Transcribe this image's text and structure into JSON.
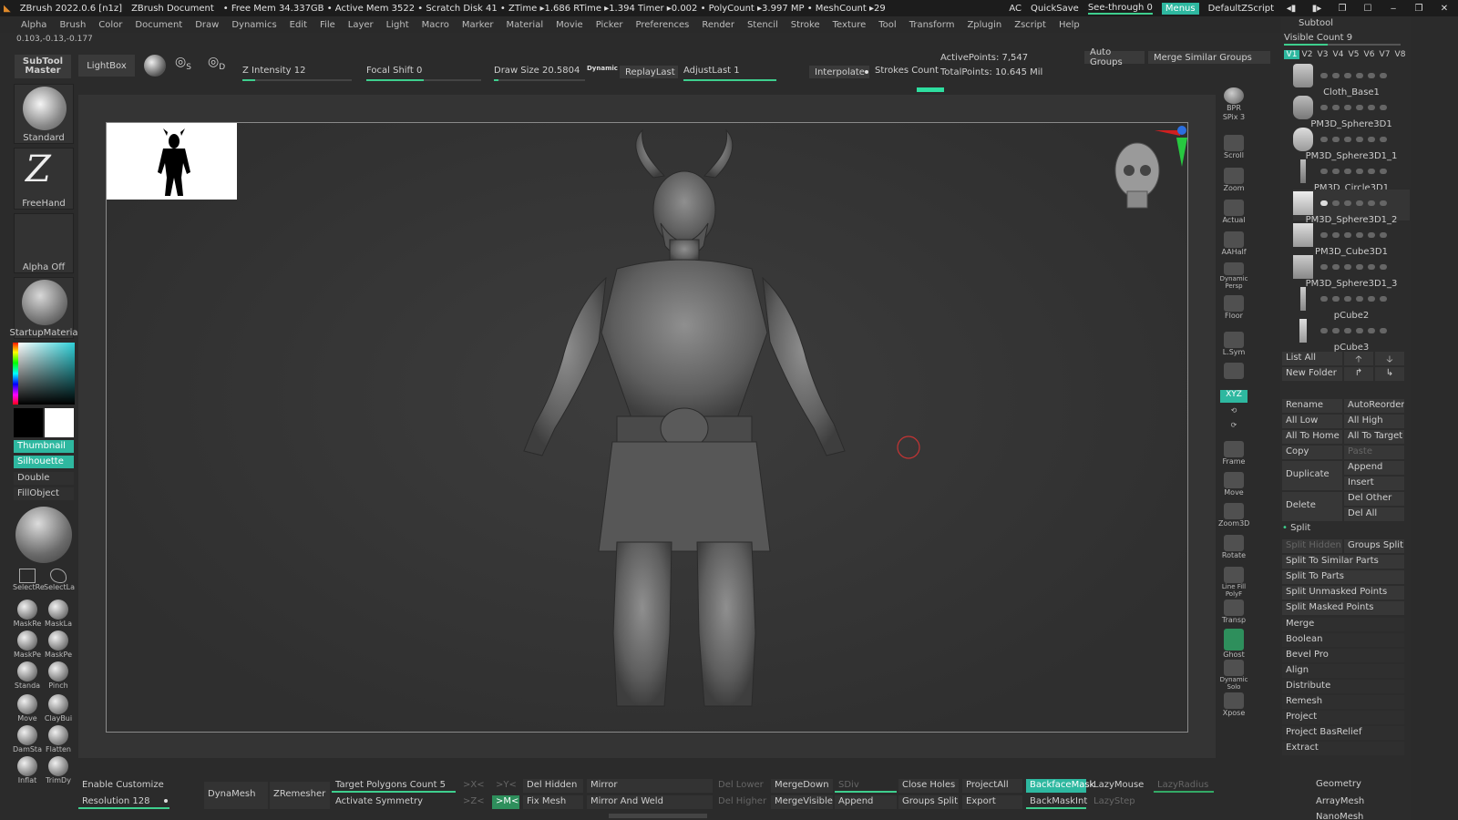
{
  "title_bar": {
    "app": "ZBrush 2022.0.6 [n1z]",
    "document": "ZBrush Document",
    "stats": "• Free Mem 34.337GB • Active Mem 3522 • Scratch Disk 41 • ZTime ▸1.686 RTime ▸1.394 Timer ▸0.002 • PolyCount ▸3.997 MP • MeshCount ▸29",
    "ac": "AC",
    "quicksave": "QuickSave",
    "see_through": "See-through   0",
    "menus": "Menus",
    "zscript": "DefaultZScript"
  },
  "menu": [
    "Alpha",
    "Brush",
    "Color",
    "Document",
    "Draw",
    "Dynamics",
    "Edit",
    "File",
    "Layer",
    "Light",
    "Macro",
    "Marker",
    "Material",
    "Movie",
    "Picker",
    "Preferences",
    "Render",
    "Stencil",
    "Stroke",
    "Texture",
    "Tool",
    "Transform",
    "Zplugin",
    "Zscript",
    "Help"
  ],
  "coords": "0.103,-0.13,-0.177",
  "top": {
    "subtool_master": "SubTool Master",
    "lightbox": "LightBox",
    "z_intensity": "Z Intensity 12",
    "focal_shift": "Focal Shift 0",
    "draw_size": "Draw Size 20.5804",
    "dynamic": "Dynamic",
    "replay_last": "ReplayLast",
    "adjust_last": "AdjustLast 1",
    "interpolate": "Interpolate",
    "strokes_count": "Strokes Count",
    "active_points": "ActivePoints: 7,547",
    "total_points": "TotalPoints: 10.645 Mil",
    "auto_groups": "Auto Groups",
    "merge_similar": "Merge Similar Groups",
    "z_intensity_level": 0.12,
    "focal_shift_level": 0.5,
    "draw_size_level": 0.05,
    "adjust_last_level": 1.0
  },
  "left": {
    "standard": "Standard",
    "freehand": "FreeHand",
    "alpha_off": "Alpha Off",
    "material": "StartupMateria",
    "thumbnail": "Thumbnail",
    "silhouette": "Silhouette",
    "double": "Double",
    "fillobject": "FillObject",
    "brushes": [
      "SelectRe",
      "SelectLa",
      "MaskRe",
      "MaskLa",
      "MaskPe",
      "MaskPe",
      "Standa",
      "Pinch",
      "Move",
      "ClayBui",
      "DamSta",
      "Flatten",
      "Inflat",
      "TrimDy"
    ]
  },
  "dock": [
    "BPR",
    "SPix 3",
    "Scroll",
    "Zoom",
    "Actual",
    "AAHalf",
    "Dynamic Persp",
    "Floor",
    "L.Sym",
    "",
    "XYZ",
    "",
    "",
    "Frame",
    "Move",
    "Zoom3D",
    "Rotate",
    "Line Fill PolyF",
    "Transp",
    "Ghost",
    "Dynamic Solo",
    "Xpose"
  ],
  "subtool": {
    "header": "Subtool",
    "visible_count": "Visible Count 9",
    "versions": [
      "V1",
      "V2",
      "V3",
      "V4",
      "V5",
      "V6",
      "V7",
      "V8"
    ],
    "items": [
      "Cloth_Base1",
      "PM3D_Sphere3D1",
      "PM3D_Sphere3D1_1",
      "PM3D_Circle3D1",
      "PM3D_Sphere3D1_2",
      "PM3D_Cube3D1",
      "PM3D_Sphere3D1_3",
      "pCube2",
      "pCube3"
    ],
    "list_all": "List All",
    "new_folder": "New Folder",
    "rename": "Rename",
    "autoreorder": "AutoReorder",
    "all_low": "All Low",
    "all_high": "All High",
    "all_to_home": "All To Home",
    "all_to_target": "All To Target",
    "copy": "Copy",
    "paste": "Paste",
    "duplicate": "Duplicate",
    "append": "Append",
    "insert": "Insert",
    "delete": "Delete",
    "del_other": "Del Other",
    "del_all": "Del All",
    "split": "Split",
    "split_hidden": "Split Hidden",
    "groups_split": "Groups Split",
    "split_similar": "Split To Similar Parts",
    "split_parts": "Split To Parts",
    "split_unmasked": "Split Unmasked Points",
    "split_masked": "Split Masked Points",
    "sections": [
      "Merge",
      "Boolean",
      "Bevel Pro",
      "Align",
      "Distribute",
      "Remesh",
      "Project",
      "Project BasRelief",
      "Extract"
    ],
    "geometry": "Geometry",
    "arraymesh": "ArrayMesh",
    "nanomesh": "NanoMesh"
  },
  "bottom": {
    "enable_customize": "Enable Customize",
    "resolution": "Resolution 128",
    "dynamesh": "DynaMesh",
    "zremesher": "ZRemesher",
    "target_polys": "Target Polygons Count 5",
    "activate_symmetry": "Activate Symmetry",
    "x": ">X<",
    "y": ">Y<",
    "z": ">Z<",
    "m": ">M<",
    "del_hidden": "Del Hidden",
    "fix_mesh": "Fix Mesh",
    "mirror": "Mirror",
    "mirror_weld": "Mirror And Weld",
    "del_lower": "Del Lower",
    "del_higher": "Del Higher",
    "merge_down": "MergeDown",
    "merge_visible": "MergeVisible",
    "sdiv": "SDiv",
    "append": "Append",
    "close_holes": "Close Holes",
    "groups_split": "Groups Split",
    "project_all": "ProjectAll",
    "export": "Export",
    "backface_mask": "BackfaceMask",
    "backmask_int": "BackMaskInt",
    "lazymouse": "LazyMouse",
    "lazystep": "LazyStep",
    "lazyradius": "LazyRadius"
  },
  "colors": {
    "accent": "#2eb8a0",
    "slider": "#3ecf8e"
  }
}
